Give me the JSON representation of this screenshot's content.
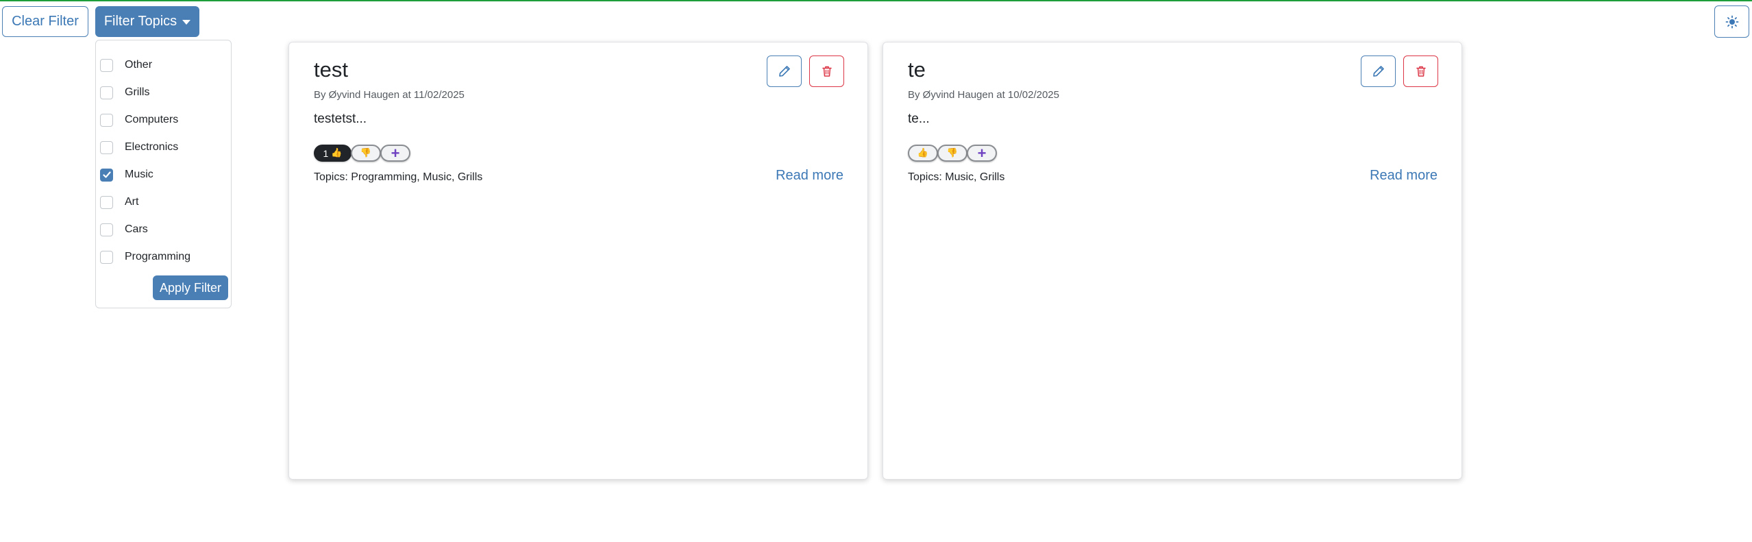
{
  "toolbar": {
    "clear_filter_label": "Clear Filter",
    "filter_topics_label": "Filter Topics",
    "theme_icon": "sun-icon"
  },
  "filter_dropdown": {
    "topics": [
      {
        "label": "Other",
        "checked": false
      },
      {
        "label": "Grills",
        "checked": false
      },
      {
        "label": "Computers",
        "checked": false
      },
      {
        "label": "Electronics",
        "checked": false
      },
      {
        "label": "Music",
        "checked": true
      },
      {
        "label": "Art",
        "checked": false
      },
      {
        "label": "Cars",
        "checked": false
      },
      {
        "label": "Programming",
        "checked": false
      }
    ],
    "apply_label": "Apply Filter"
  },
  "posts": [
    {
      "title": "test",
      "meta": "By Øyvind Haugen at 11/02/2025",
      "excerpt": "testetst...",
      "likes": "1",
      "like_icon": "👍",
      "dislike_icon": "👎",
      "add_icon": "+",
      "topics": "Topics: Programming, Music, Grills",
      "read_more": "Read more"
    },
    {
      "title": "te",
      "meta": "By Øyvind Haugen at 10/02/2025",
      "excerpt": "te...",
      "likes": "",
      "like_icon": "👍",
      "dislike_icon": "👎",
      "add_icon": "+",
      "topics": "Topics: Music, Grills",
      "read_more": "Read more"
    }
  ],
  "colors": {
    "primary": "#4a7fb5",
    "danger": "#dc3545",
    "top_border": "#1e9e3a",
    "add_icon": "#6f42c1",
    "thumb": "#f0a030"
  }
}
